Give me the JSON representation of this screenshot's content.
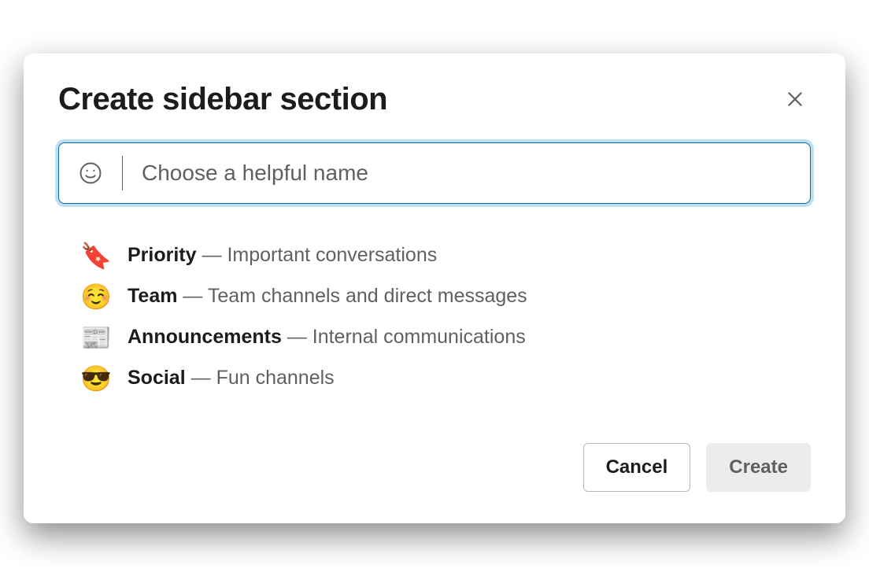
{
  "modal": {
    "title": "Create sidebar section",
    "input": {
      "placeholder": "Choose a helpful name",
      "value": ""
    },
    "suggestions": [
      {
        "icon": "🔖",
        "name": "Priority",
        "desc": "Important conversations"
      },
      {
        "icon": "☺️",
        "name": "Team",
        "desc": "Team channels and direct messages"
      },
      {
        "icon": "📰",
        "name": "Announcements",
        "desc": "Internal communications"
      },
      {
        "icon": "😎",
        "name": "Social",
        "desc": "Fun channels"
      }
    ],
    "buttons": {
      "cancel": "Cancel",
      "create": "Create"
    }
  }
}
